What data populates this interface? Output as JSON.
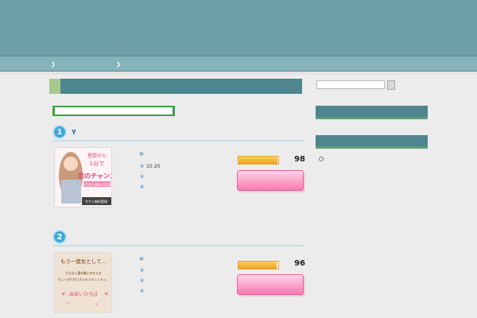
{
  "header": {
    "site_title": "",
    "site_description": "",
    "intro_text": ""
  },
  "nav": {
    "items": [
      {
        "label": ""
      },
      {
        "label": ""
      }
    ]
  },
  "main": {
    "page_title": "",
    "intro_note": "",
    "rankings": [
      {
        "rank": "1",
        "name": "Y",
        "points_label": "",
        "points": [
          "10 20",
          "",
          ""
        ],
        "score_label": "",
        "score": 98,
        "score_display": "98",
        "cta_label": "",
        "banner": {
          "line1": "登録から",
          "line2": "1分で",
          "line3": "恋のチャンス",
          "line4": "今日から始める恋活!",
          "button": "今すぐ無料登録"
        }
      },
      {
        "rank": "2",
        "name": "",
        "points_label": "",
        "points": [
          "",
          "",
          ""
        ],
        "score_label": "",
        "score": 96,
        "score_display": "96",
        "cta_label": "",
        "banner": {
          "line1": "もう一度女として...",
          "line2": "そんな人妻の願いを叶える",
          "line3": "ちょっぴり甘い大人のコミュニティ。",
          "line4": "出会いひろば"
        }
      }
    ]
  },
  "sidebar": {
    "search_placeholder": "",
    "widget_titles": [
      "",
      ""
    ],
    "links": [
      ""
    ]
  },
  "colors": {
    "header_bg": "#6e9ea8",
    "nav_bg": "#86b3bb",
    "title_bar": "#4f858e",
    "intro_green": "#3ea23e",
    "rank_blue": "#3da7d8",
    "cta_pink": "#f77ab1"
  },
  "icons": [
    "chevron-right-icon",
    "star-icon",
    "check-icon",
    "search-icon",
    "circle-bullet-icon"
  ]
}
